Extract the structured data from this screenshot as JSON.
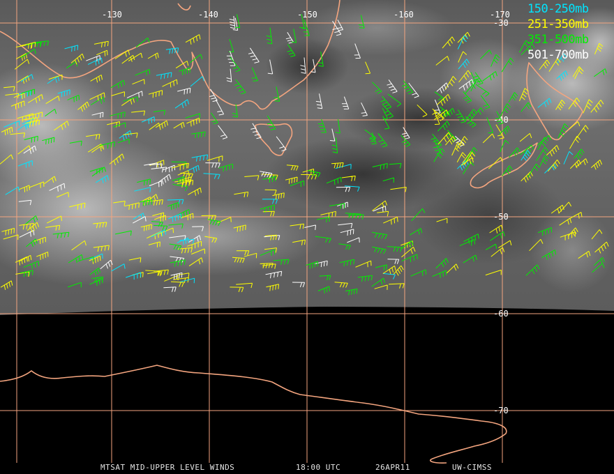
{
  "legend": {
    "items": [
      {
        "label": "150-250mb",
        "color": "#00e5ff"
      },
      {
        "label": "251-350mb",
        "color": "#ffff00"
      },
      {
        "label": "351-500mb",
        "color": "#00ee00"
      },
      {
        "label": "501-700mb",
        "color": "#ffffff"
      }
    ]
  },
  "grid": {
    "longitude_labels": [
      "-130",
      "-140",
      "-150",
      "-160",
      "-170"
    ],
    "latitude_labels": [
      "-30",
      "-40",
      "-50",
      "-60",
      "-70"
    ],
    "line_color": "#f4a57f"
  },
  "coast_color": "#f4a57f",
  "footer": {
    "product": "MTSAT MID-UPPER LEVEL WINDS",
    "time": "18:00 UTC",
    "date": "26APR11",
    "source": "UW-CIMSS"
  }
}
